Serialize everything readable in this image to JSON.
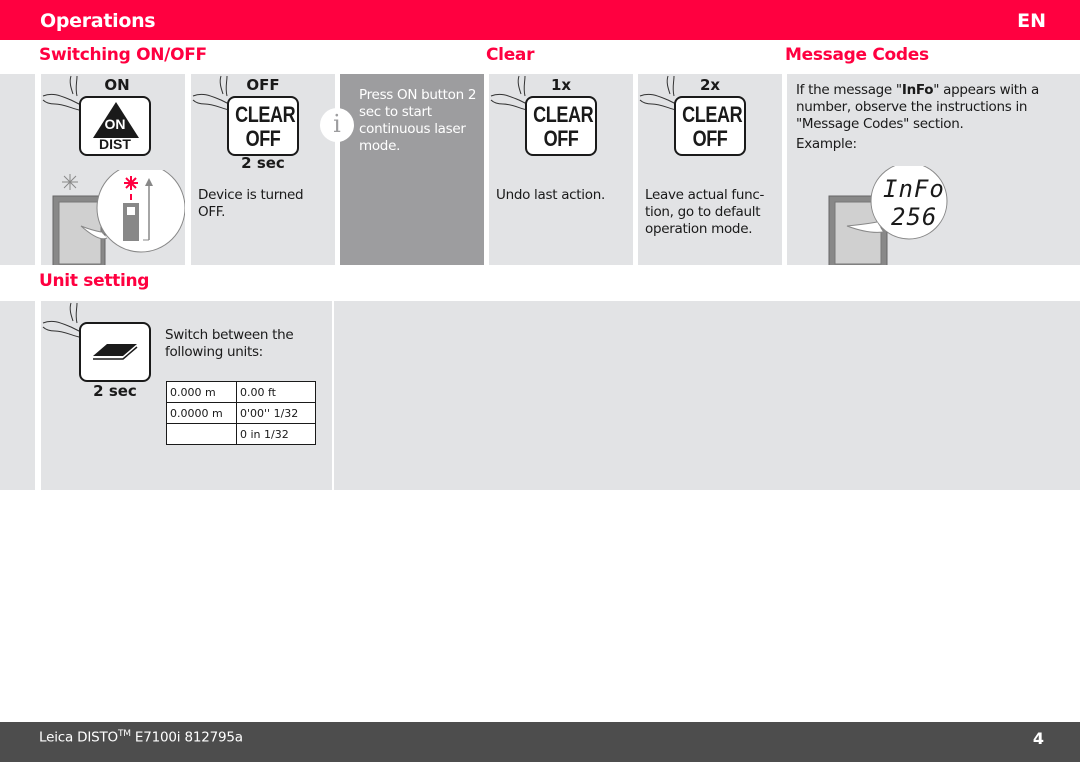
{
  "header": {
    "title": "Operations",
    "language": "EN"
  },
  "colors": {
    "brand_red": "#ff0040",
    "panel_gray": "#e2e3e5",
    "info_panel_gray": "#9d9d9f",
    "footer_gray": "#4d4d4d"
  },
  "sections": {
    "switching": {
      "title": "Switching ON/OFF",
      "on_step": {
        "label": "ON",
        "button_top": "ON",
        "button_bottom": "DIST",
        "icon": "on-dist-button-icon"
      },
      "off_step": {
        "label": "OFF",
        "button_line1": "CLEAR",
        "button_line2": "OFF",
        "duration": "2 sec",
        "description": "Device is turned OFF."
      },
      "info_note": {
        "icon": "info-icon",
        "text": "Press ON button 2 sec to start continuous laser mode."
      }
    },
    "clear": {
      "title": "Clear",
      "steps": [
        {
          "label": "1x",
          "button_line1": "CLEAR",
          "button_line2": "OFF",
          "description": "Undo last action."
        },
        {
          "label": "2x",
          "button_line1": "CLEAR",
          "button_line2": "OFF",
          "description": "Leave actual func- tion, go to default operation mode."
        }
      ]
    },
    "message_codes": {
      "title": "Message Codes",
      "text_pre": "If the message \"",
      "text_bold": "InFo",
      "text_post": "\" appears with a number, observe the instructions in \"Message Codes\" section.",
      "example_label": "Example:",
      "display_line1": "InFo",
      "display_line2": "256"
    },
    "unit_setting": {
      "title": "Unit setting",
      "duration": "2 sec",
      "description": "Switch between the following units:",
      "units": [
        [
          "0.000 m",
          "0.00 ft"
        ],
        [
          "0.0000 m",
          "0'00'' 1/32"
        ],
        [
          "",
          "0 in 1/32"
        ]
      ]
    }
  },
  "footer": {
    "doc_prefix": "Leica DISTO",
    "doc_trademark": "TM",
    "doc_suffix": " E7100i 812795a",
    "page_number": "4"
  }
}
